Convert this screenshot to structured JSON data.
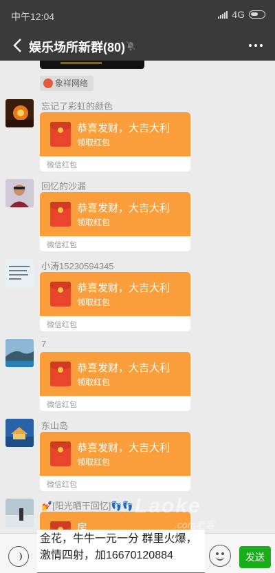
{
  "status_bar": {
    "time": "中午12:04",
    "network": "4G"
  },
  "header": {
    "title": "娱乐场所新群(80)"
  },
  "chat": {
    "source_tag": "象祥网络",
    "messages": [
      {
        "sender": "忘记了彩虹的颜色",
        "greeting": "恭喜发财，大吉大利",
        "action": "领取红包",
        "label": "微信红包"
      },
      {
        "sender": "回忆的沙漏",
        "greeting": "恭喜发财，大吉大利",
        "action": "领取红包",
        "label": "微信红包"
      },
      {
        "sender": "小涛15230594345",
        "greeting": "恭喜发财，大吉大利",
        "action": "领取红包",
        "label": "微信红包"
      },
      {
        "sender": "7",
        "greeting": "恭喜发财，大吉大利",
        "action": "领取红包",
        "label": "微信红包"
      },
      {
        "sender": "东山岛",
        "greeting": "恭喜发财，大吉大利",
        "action": "领取红包",
        "label": "微信红包"
      },
      {
        "sender": "💅[阳光晒干回忆]👣👣",
        "greeting": "房",
        "action": "",
        "label": ""
      }
    ],
    "watermark": "Laoke",
    "watermark_sub": ".com老客"
  },
  "input_bar": {
    "text": "金花，牛牛一元一分  群里火爆，激情四射，加16670120884",
    "send_label": "发送"
  },
  "colors": {
    "bar": "#3a3a3a",
    "packet": "#fa9d3b",
    "send": "#1aad19"
  }
}
